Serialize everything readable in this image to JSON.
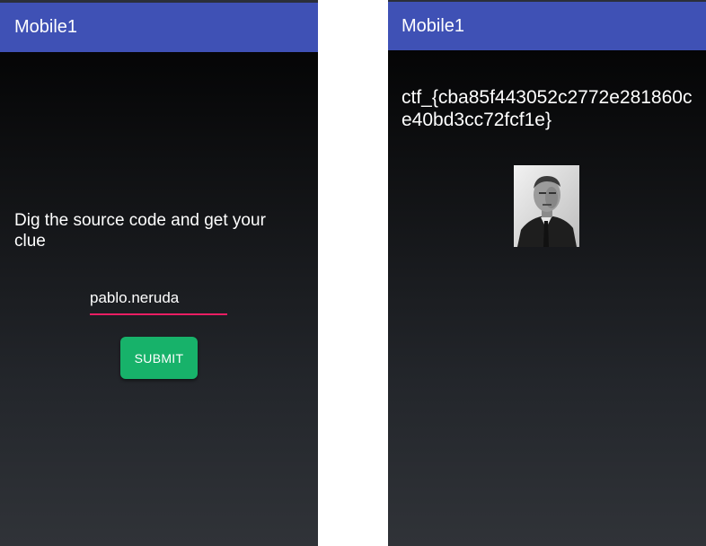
{
  "screens": {
    "login": {
      "app_title": "Mobile1",
      "prompt": "Dig the source code and get your clue",
      "username_value": "pablo.neruda",
      "submit_label": "SUBMIT"
    },
    "result": {
      "app_title": "Mobile1",
      "flag_text": "ctf_{cba85f443052c2772e281860ce40bd3cc72fcf1e}",
      "image_icon": "portrait-photo"
    }
  },
  "colors": {
    "app_bar": "#3f51b5",
    "submit_button": "#17b26a",
    "input_underline": "#e91e63"
  }
}
